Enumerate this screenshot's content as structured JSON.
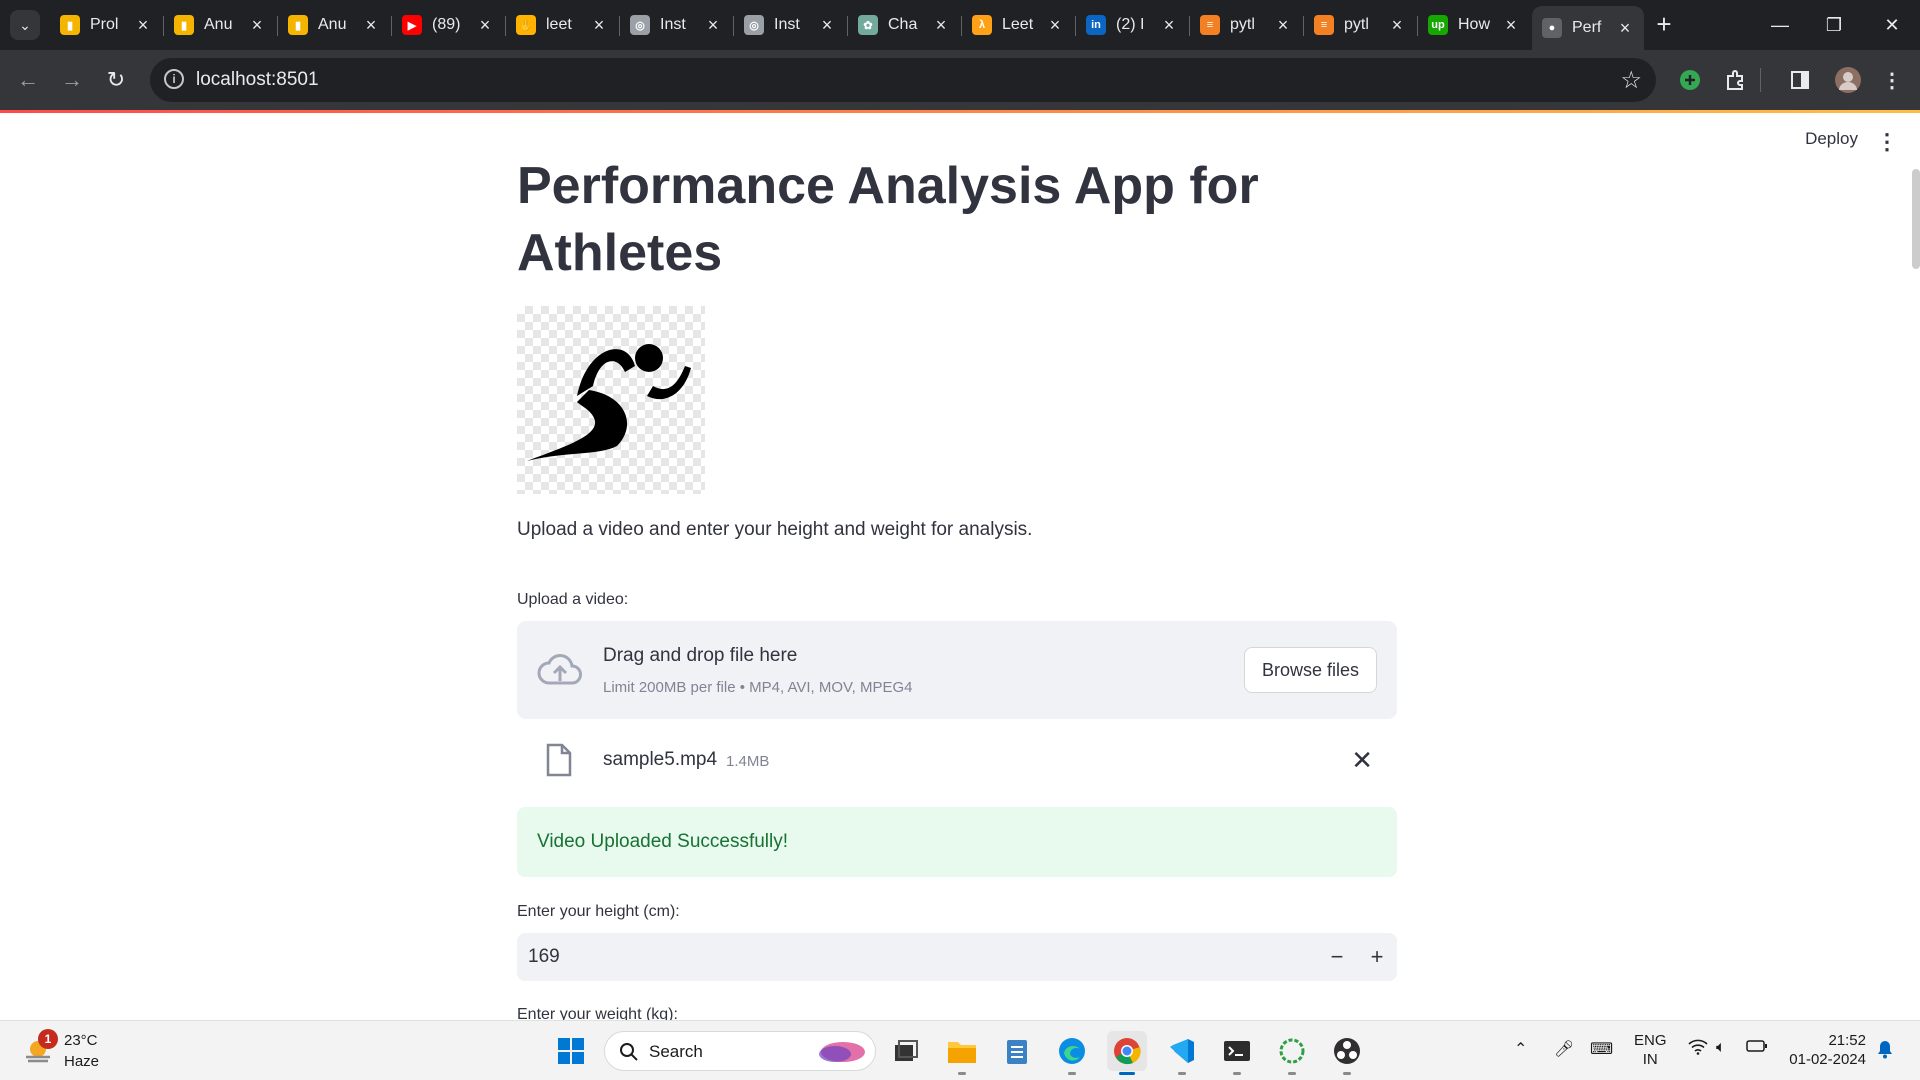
{
  "browser": {
    "tabs": [
      {
        "title": "Prol",
        "favicon": "bar-chart-icon",
        "color": "#f4b400"
      },
      {
        "title": "Anu",
        "favicon": "bar-chart-icon",
        "color": "#f4b400"
      },
      {
        "title": "Anu",
        "favicon": "bar-chart-icon",
        "color": "#f4b400"
      },
      {
        "title": "(89)",
        "favicon": "youtube-icon",
        "color": "#ff0000"
      },
      {
        "title": "leet",
        "favicon": "hand-icon",
        "color": "#ffb300"
      },
      {
        "title": "Inst",
        "favicon": "circle-logo-icon",
        "color": "#9aa0a6"
      },
      {
        "title": "Inst",
        "favicon": "circle-logo-icon",
        "color": "#9aa0a6"
      },
      {
        "title": "Cha",
        "favicon": "chatgpt-icon",
        "color": "#74aa9c"
      },
      {
        "title": "Leet",
        "favicon": "leetcode-icon",
        "color": "#ffa116"
      },
      {
        "title": "(2) I",
        "favicon": "linkedin-icon",
        "color": "#0a66c2"
      },
      {
        "title": "pytl",
        "favicon": "stack-icon",
        "color": "#f48024"
      },
      {
        "title": "pytl",
        "favicon": "stack-icon",
        "color": "#f48024"
      },
      {
        "title": "How",
        "favicon": "upwork-icon",
        "color": "#14a800"
      },
      {
        "title": "Perf",
        "favicon": "page-icon",
        "color": "#5f6368"
      }
    ],
    "url": "localhost:8501"
  },
  "app": {
    "deploy_label": "Deploy",
    "title": "Performance Analysis App for Athletes",
    "lead": "Upload a video and enter your height and weight for analysis.",
    "upload_label": "Upload a video:",
    "dropzone_title": "Drag and drop file here",
    "dropzone_limit": "Limit 200MB per file • MP4, AVI, MOV, MPEG4",
    "browse_label": "Browse files",
    "file_name": "sample5.mp4",
    "file_size": "1.4MB",
    "success_message": "Video Uploaded Successfully!",
    "height_label": "Enter your height (cm):",
    "height_value": "169",
    "weight_label": "Enter your weight (kg):"
  },
  "taskbar": {
    "notification_count": "1",
    "temperature": "23°C",
    "weather": "Haze",
    "search_label": "Search",
    "lang_1": "ENG",
    "lang_2": "IN",
    "time": "21:52",
    "date": "01-02-2024"
  }
}
